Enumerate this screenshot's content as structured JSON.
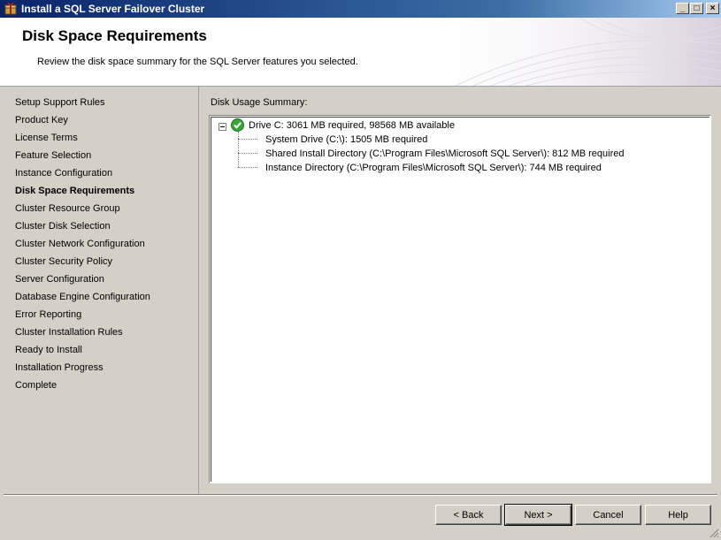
{
  "window": {
    "title": "Install a SQL Server Failover Cluster",
    "controls": {
      "minimize": "_",
      "maximize": "□",
      "close": "×"
    }
  },
  "header": {
    "title": "Disk Space Requirements",
    "subtitle": "Review the disk space summary for the SQL Server features you selected."
  },
  "nav": {
    "items": [
      {
        "label": "Setup Support Rules"
      },
      {
        "label": "Product Key"
      },
      {
        "label": "License Terms"
      },
      {
        "label": "Feature Selection"
      },
      {
        "label": "Instance Configuration"
      },
      {
        "label": "Disk Space Requirements",
        "active": true
      },
      {
        "label": "Cluster Resource Group"
      },
      {
        "label": "Cluster Disk Selection"
      },
      {
        "label": "Cluster Network Configuration"
      },
      {
        "label": "Cluster Security Policy"
      },
      {
        "label": "Server Configuration"
      },
      {
        "label": "Database Engine Configuration"
      },
      {
        "label": "Error Reporting"
      },
      {
        "label": "Cluster Installation Rules"
      },
      {
        "label": "Ready to Install"
      },
      {
        "label": "Installation Progress"
      },
      {
        "label": "Complete"
      }
    ]
  },
  "content": {
    "label": "Disk Usage Summary:",
    "tree": {
      "root": "Drive C: 3061 MB required, 98568 MB available",
      "children": [
        "System Drive (C:\\): 1505 MB required",
        "Shared Install Directory (C:\\Program Files\\Microsoft SQL Server\\): 812 MB required",
        "Instance Directory (C:\\Program Files\\Microsoft SQL Server\\): 744 MB required"
      ]
    }
  },
  "buttons": {
    "back": "< Back",
    "next": "Next >",
    "cancel": "Cancel",
    "help": "Help"
  },
  "colors": {
    "titlebar_start": "#0a246a",
    "window_face": "#d4d0c8",
    "success_green": "#3aa63a"
  }
}
